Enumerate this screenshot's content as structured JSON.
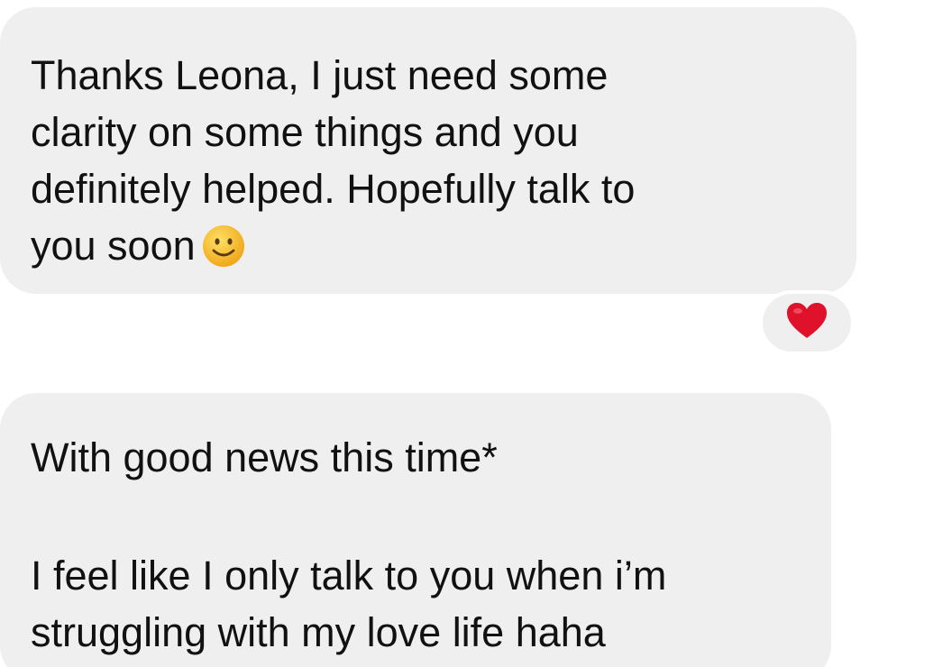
{
  "messages": [
    {
      "lines": [
        "Thanks Leona, I just need some",
        "clarity on some things and you",
        "definitely helped. Hopefully talk to",
        "you soon"
      ],
      "trailing_icon": "slightly-smiling-face-icon",
      "reaction": "red-heart-icon"
    },
    {
      "paragraph_1": [
        "With good news this time*"
      ],
      "paragraph_2": [
        "I feel like I only talk to you when i’m",
        "struggling with my love life haha"
      ]
    }
  ],
  "colors": {
    "bubble_background": "#efefef",
    "text": "#111111",
    "heart": "#e0112b",
    "emoji_face": "#f7c21e"
  }
}
